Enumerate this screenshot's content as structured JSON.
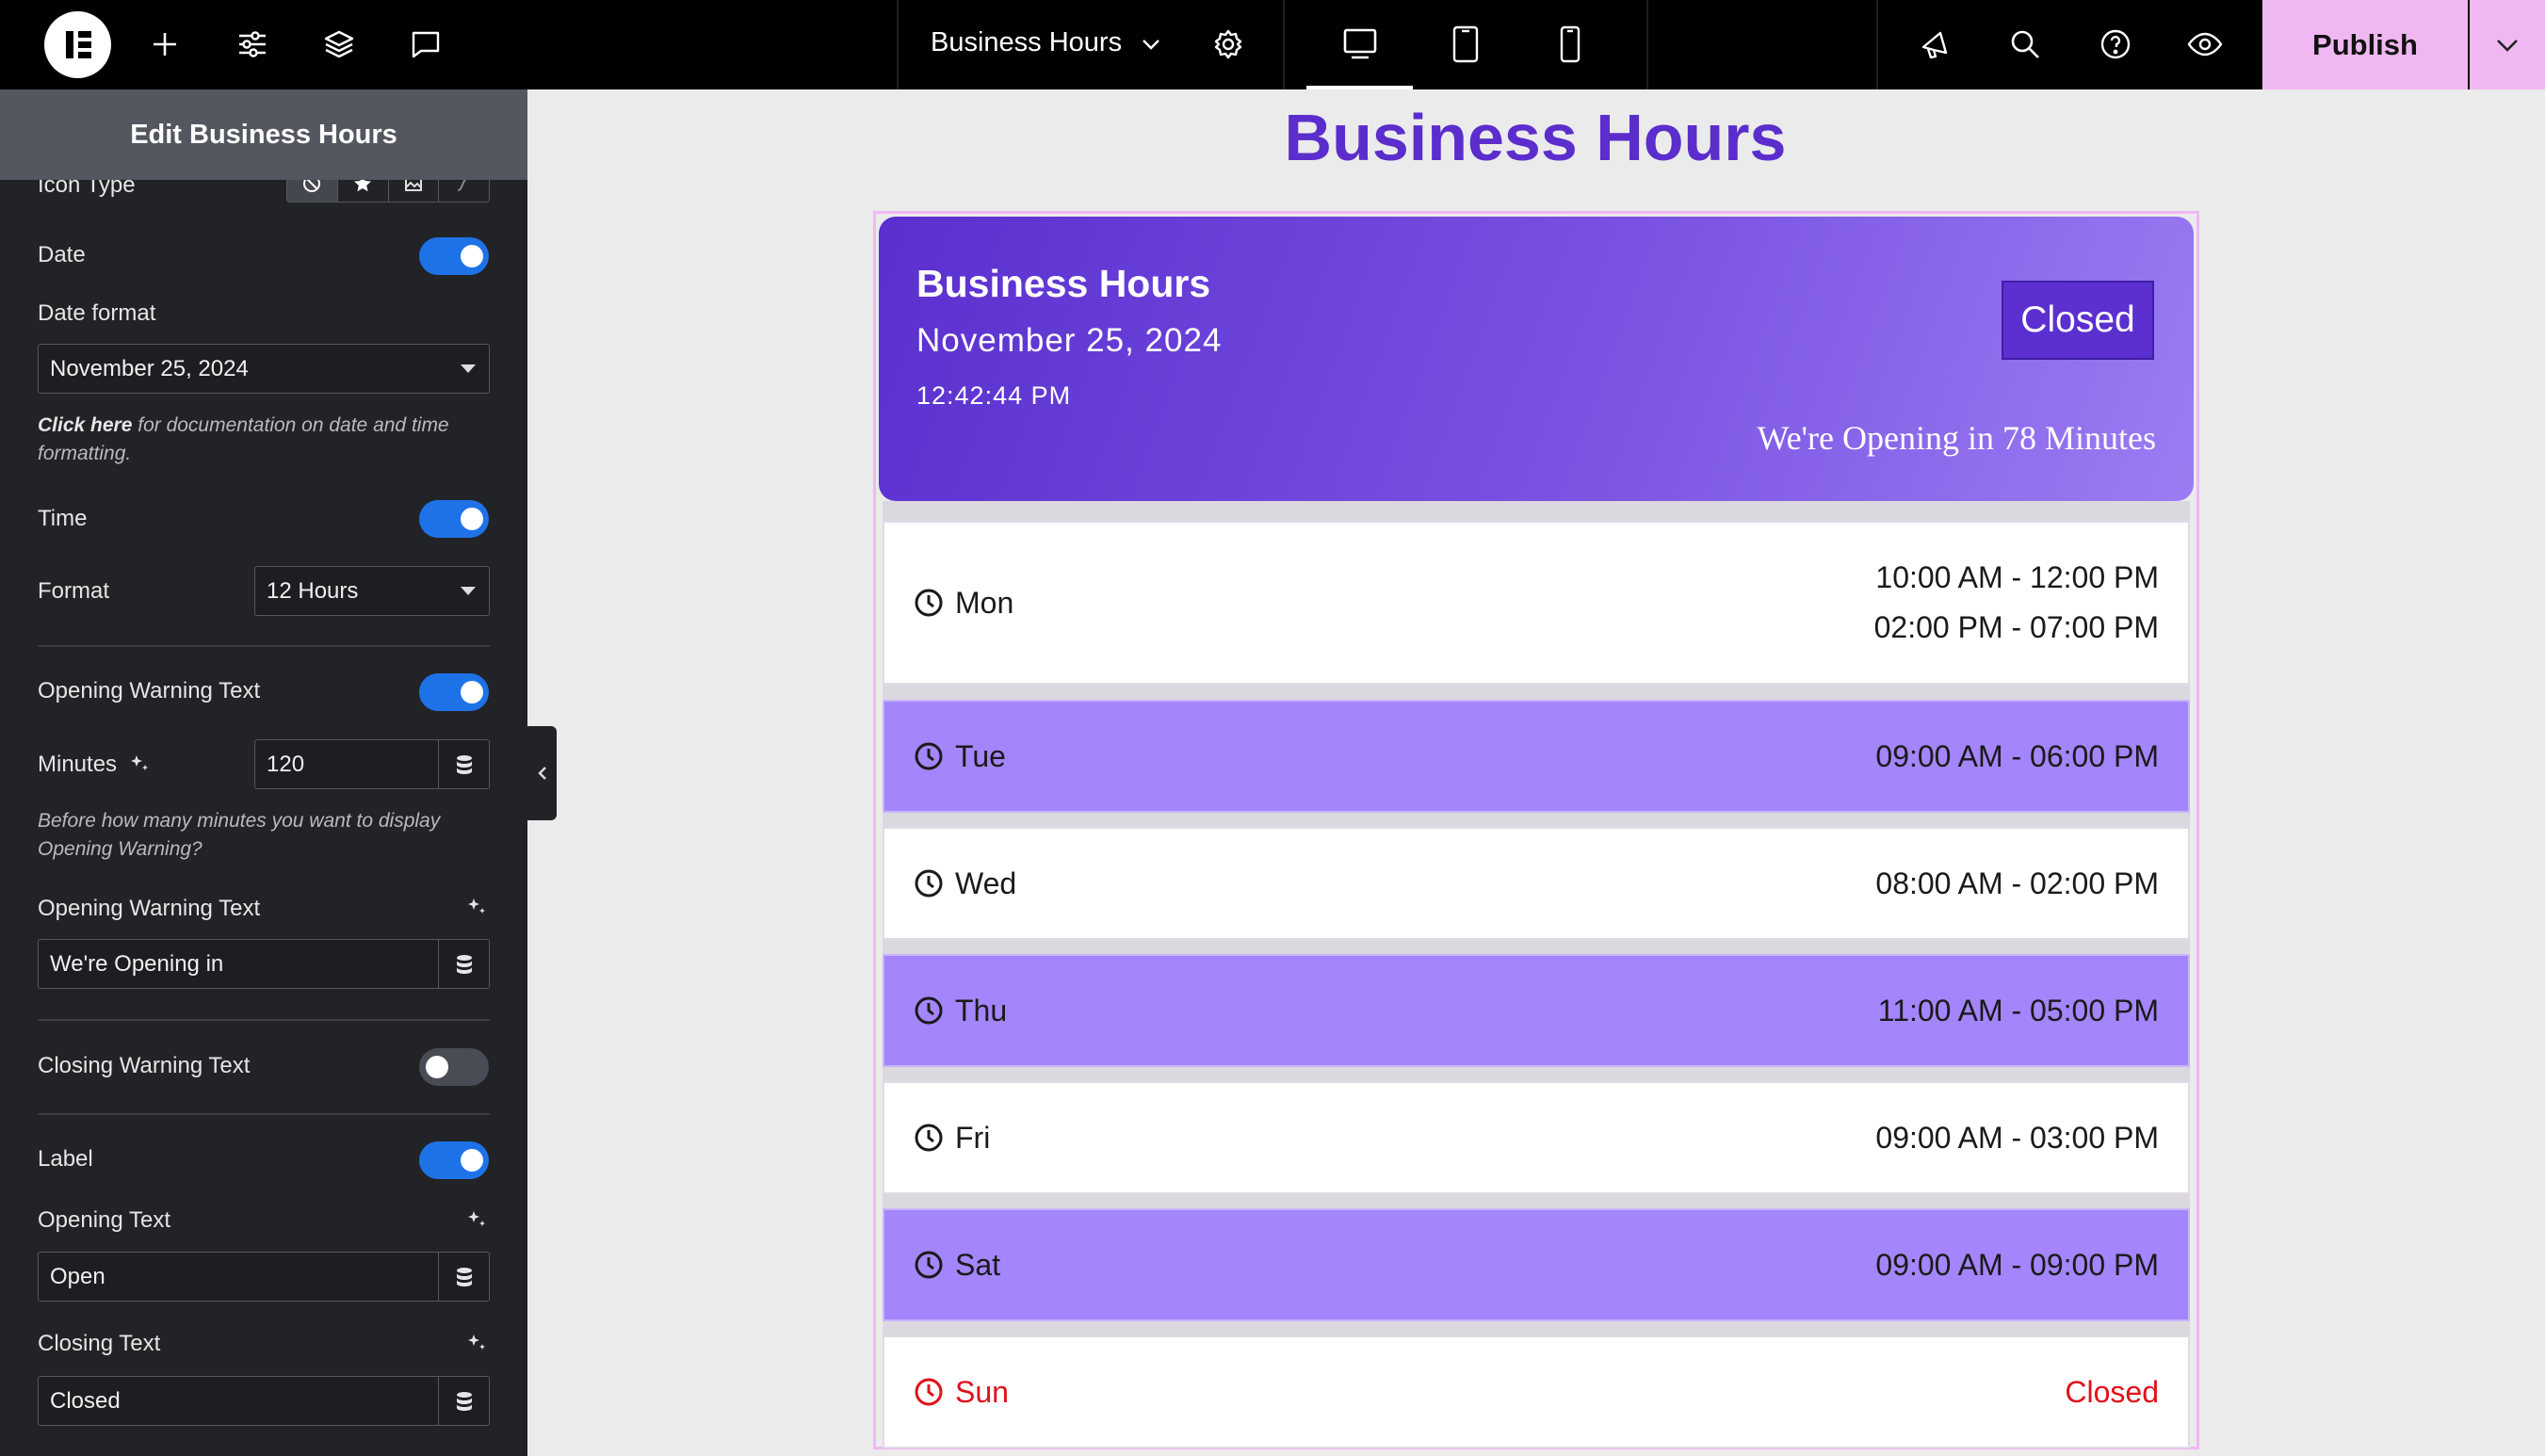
{
  "topbar": {
    "document_title": "Business Hours",
    "publish_label": "Publish",
    "icons": [
      "add-icon",
      "settings-sliders-icon",
      "layers-icon",
      "comments-icon",
      "chevron-down-icon",
      "gear-icon",
      "desktop-icon",
      "tablet-icon",
      "mobile-icon",
      "announcements-icon",
      "search-icon",
      "help-icon",
      "preview-eye-icon"
    ]
  },
  "sidebar": {
    "panel_title": "Edit Business Hours",
    "icon_type_label": "Icon Type",
    "date_label": "Date",
    "date_enabled": true,
    "date_format_label": "Date format",
    "date_format_value": "November 25, 2024",
    "date_note_link": "Click here",
    "date_note_text": "for documentation on date and time formatting.",
    "time_label": "Time",
    "time_enabled": true,
    "format_label": "Format",
    "format_value": "12 Hours",
    "opening_warning_toggle_label": "Opening Warning Text",
    "opening_warning_enabled": true,
    "minutes_label": "Minutes",
    "minutes_value": "120",
    "minutes_note": "Before how many minutes you want to display Opening Warning?",
    "opening_warning_text_label": "Opening Warning Text",
    "opening_warning_text_value": "We're Opening in",
    "closing_warning_label": "Closing Warning Text",
    "closing_warning_enabled": false,
    "label_label": "Label",
    "label_enabled": true,
    "opening_text_label": "Opening Text",
    "opening_text_value": "Open",
    "closing_text_label": "Closing Text",
    "closing_text_value": "Closed"
  },
  "canvas": {
    "page_heading": "Business Hours",
    "hero": {
      "title": "Business Hours",
      "date": "November 25, 2024",
      "time": "12:42:44 PM",
      "status_badge": "Closed",
      "warning": "We're Opening in 78 Minutes"
    },
    "days": [
      {
        "day": "Mon",
        "hours": [
          "10:00 AM - 12:00 PM",
          "02:00 PM - 07:00 PM"
        ]
      },
      {
        "day": "Tue",
        "hours": [
          "09:00 AM - 06:00 PM"
        ]
      },
      {
        "day": "Wed",
        "hours": [
          "08:00 AM - 02:00 PM"
        ]
      },
      {
        "day": "Thu",
        "hours": [
          "11:00 AM - 05:00 PM"
        ]
      },
      {
        "day": "Fri",
        "hours": [
          "09:00 AM - 03:00 PM"
        ]
      },
      {
        "day": "Sat",
        "hours": [
          "09:00 AM - 09:00 PM"
        ]
      },
      {
        "day": "Sun",
        "hours": [
          "Closed"
        ]
      }
    ]
  },
  "colors": {
    "accent_purple": "#5b2dcc",
    "row_alt": "#a485fb",
    "closed_red": "#e0111b",
    "publish_bg": "#f0b8f2",
    "toggle_on": "#1e72e8"
  }
}
